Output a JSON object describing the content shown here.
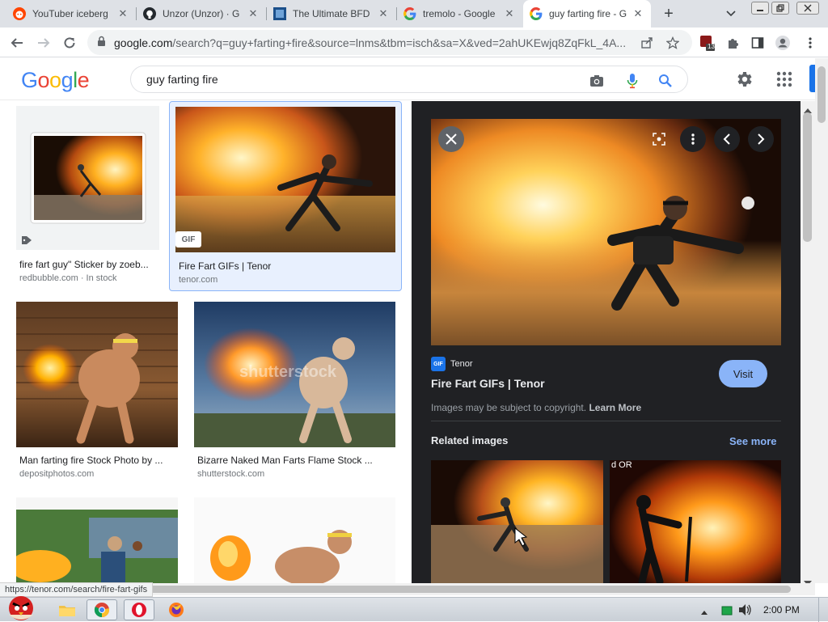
{
  "browser": {
    "tabs": [
      {
        "title": "YouTuber iceberg",
        "favicon": "reddit-icon",
        "active": false
      },
      {
        "title": "Unzor (Unzor) · G",
        "favicon": "github-icon",
        "active": false
      },
      {
        "title": "The Ultimate BFD",
        "favicon": "site-icon",
        "active": false
      },
      {
        "title": "tremolo - Google",
        "favicon": "google-icon",
        "active": false
      },
      {
        "title": "guy farting fire - G",
        "favicon": "google-icon",
        "active": true
      }
    ],
    "new_tab_label": "+",
    "url_host": "google.com",
    "url_rest": "/search?q=guy+farting+fire&source=lnms&tbm=isch&sa=X&ved=2ahUKEwjq8ZqFkL_4A...",
    "extension_badge": "13"
  },
  "google": {
    "logo_letters": [
      "G",
      "o",
      "o",
      "g",
      "l",
      "e"
    ],
    "logo_colors": [
      "#4285f4",
      "#ea4335",
      "#fbbc05",
      "#4285f4",
      "#34a853",
      "#ea4335"
    ],
    "query": "guy farting fire"
  },
  "results": [
    {
      "caption": "fire fart guy\" Sticker by zoeb...",
      "source": "redbubble.com · In stock",
      "badge": ""
    },
    {
      "caption": "Fire Fart GIFs | Tenor",
      "source": "tenor.com",
      "badge": "GIF"
    },
    {
      "caption": "Man farting fire Stock Photo by ...",
      "source": "depositphotos.com",
      "badge": ""
    },
    {
      "caption": "Bizarre Naked Man Farts Flame Stock ...",
      "source": "shutterstock.com",
      "badge": ""
    }
  ],
  "watermark": "shutterstock",
  "preview": {
    "site_badge": "GIF",
    "site": "Tenor",
    "title": "Fire Fart GIFs | Tenor",
    "visit_label": "Visit",
    "copyright_text": "Images may be subject to copyright.",
    "learn_more": "Learn More",
    "related_heading": "Related images",
    "see_more": "See more",
    "related_overlay_text": "d OR"
  },
  "status_url": "https://tenor.com/search/fire-fart-gifs",
  "taskbar": {
    "clock": "2:00 PM"
  },
  "colors": {
    "accent": "#1a73e8",
    "panel_bg": "#202124",
    "link_blue": "#8ab4f8"
  }
}
